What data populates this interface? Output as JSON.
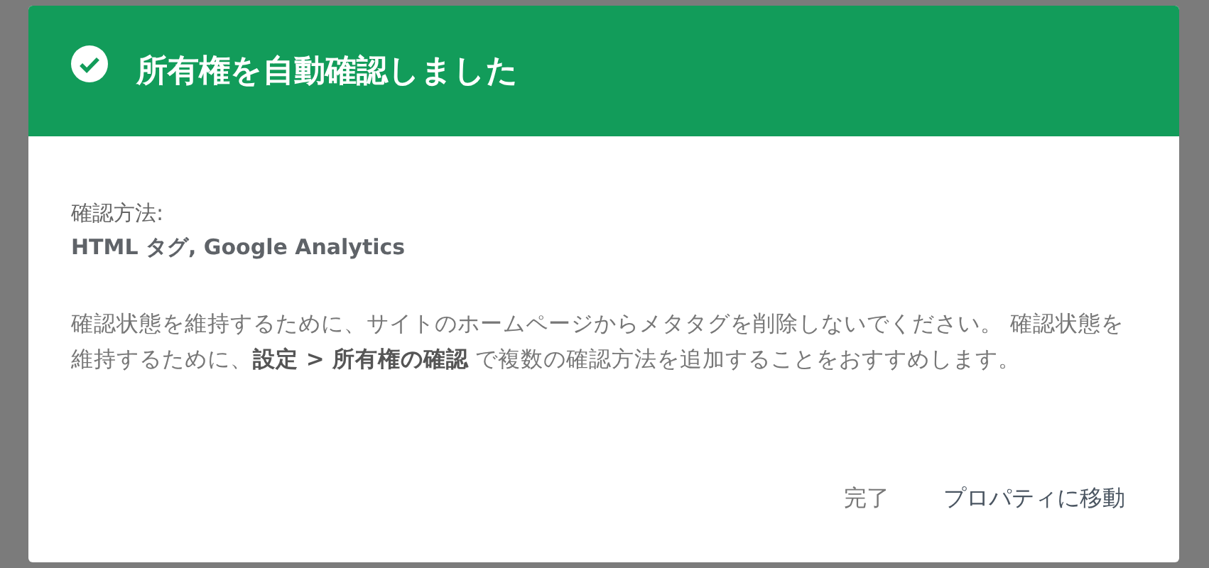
{
  "dialog": {
    "title": "所有権を自動確認しました",
    "method_label": "確認方法:",
    "method_value": "HTML タグ, Google Analytics",
    "message": "確認状態を維持するために、サイトのホームページからメタタグを削除しないでください。 確認状態を維持するために、**設定 > 所有権の確認** で複数の確認方法を追加することをおすすめします。",
    "buttons": [
      {
        "label": "完了",
        "kind": "secondary"
      },
      {
        "label": "プロパティに移動",
        "kind": "primary"
      }
    ]
  }
}
